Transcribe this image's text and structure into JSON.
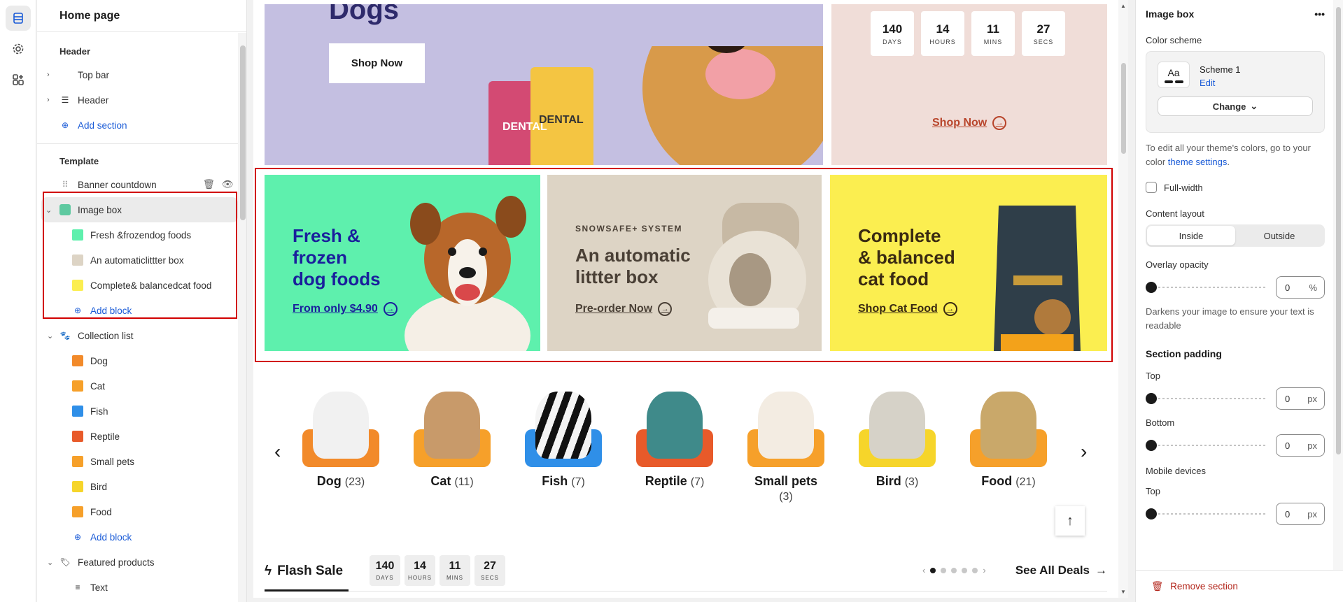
{
  "sidebar": {
    "title": "Home page",
    "header_group": "Header",
    "top_bar": "Top bar",
    "header": "Header",
    "add_section": "Add section",
    "template_group": "Template",
    "banner_countdown": "Banner countdown",
    "image_box": "Image box",
    "image_box_blocks": [
      "Fresh &frozendog foods",
      "An automaticlittter box",
      "Complete& balancedcat food"
    ],
    "add_block": "Add block",
    "collection_list": "Collection list",
    "collection_blocks": [
      "Dog",
      "Cat",
      "Fish",
      "Reptile",
      "Small pets",
      "Bird",
      "Food"
    ],
    "featured_products": "Featured products",
    "text_block": "Text"
  },
  "preview": {
    "hero": {
      "title": "Dogs",
      "button": "Shop Now",
      "countdown": [
        {
          "num": "140",
          "label": "DAYS"
        },
        {
          "num": "14",
          "label": "HOURS"
        },
        {
          "num": "11",
          "label": "MINS"
        },
        {
          "num": "27",
          "label": "SECS"
        }
      ],
      "right_link": "Shop Now"
    },
    "image_boxes": [
      {
        "title_lines": [
          "Fresh &",
          "frozen",
          "dog foods"
        ],
        "link": "From only $4.90",
        "bg": "#5ef0ad",
        "color": "#1a1f9c"
      },
      {
        "eyebrow": "SNOWSAFE+ SYSTEM",
        "title_lines": [
          "An automatic",
          "littter box"
        ],
        "link": "Pre-order Now",
        "bg": "#ddd4c5",
        "color": "#4a4036"
      },
      {
        "title_lines": [
          "Complete",
          "& balanced",
          "cat food"
        ],
        "link": "Shop Cat Food",
        "bg": "#fbee50",
        "color": "#3a2a12"
      }
    ],
    "collections": [
      {
        "name": "Dog",
        "count": "(23)",
        "color": "#f28a2a"
      },
      {
        "name": "Cat",
        "count": "(11)",
        "color": "#f6a02a"
      },
      {
        "name": "Fish",
        "count": "(7)",
        "color": "#2f8fe8"
      },
      {
        "name": "Reptile",
        "count": "(7)",
        "color": "#e85a2a"
      },
      {
        "name": "Small pets",
        "count": "(3)",
        "color": "#f6a02a"
      },
      {
        "name": "Bird",
        "count": "(3)",
        "color": "#f6d52a"
      },
      {
        "name": "Food",
        "count": "(21)",
        "color": "#f6a02a"
      }
    ],
    "flash": {
      "title": "Flash Sale",
      "countdown": [
        {
          "num": "140",
          "label": "DAYS"
        },
        {
          "num": "14",
          "label": "HOURS"
        },
        {
          "num": "11",
          "label": "MINS"
        },
        {
          "num": "27",
          "label": "SECS"
        }
      ],
      "see_all": "See All Deals"
    }
  },
  "panel": {
    "title": "Image box",
    "color_scheme_label": "Color scheme",
    "scheme_swatch": "Aa",
    "scheme_name": "Scheme 1",
    "scheme_edit": "Edit",
    "change": "Change",
    "help_prefix": "To edit all your theme's colors, go to your color ",
    "help_link": "theme settings",
    "help_suffix": ".",
    "full_width": "Full-width",
    "content_layout": "Content layout",
    "layout_options": [
      "Inside",
      "Outside"
    ],
    "overlay_opacity": "Overlay opacity",
    "overlay_value": "0",
    "overlay_unit": "%",
    "overlay_help": "Darkens your image to ensure your text is readable",
    "section_padding": "Section padding",
    "top": "Top",
    "bottom": "Bottom",
    "mobile": "Mobile devices",
    "top_mobile": "Top",
    "px_value": "0",
    "px_unit": "px",
    "remove_section": "Remove section"
  }
}
